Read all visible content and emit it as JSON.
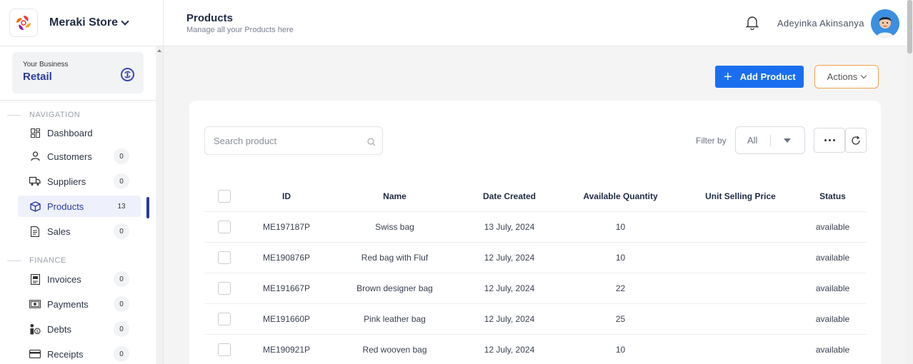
{
  "sidebar": {
    "store_name": "Meraki Store",
    "business": {
      "label": "Your Business",
      "value": "Retail"
    },
    "navigation_label": "NAVIGATION",
    "finance_label": "FINANCE",
    "nav": [
      {
        "label": "Dashboard",
        "count": "",
        "icon": "dashboard-icon"
      },
      {
        "label": "Customers",
        "count": "0",
        "icon": "user-icon"
      },
      {
        "label": "Suppliers",
        "count": "0",
        "icon": "truck-icon"
      },
      {
        "label": "Products",
        "count": "13",
        "icon": "box-icon"
      },
      {
        "label": "Sales",
        "count": "0",
        "icon": "document-icon"
      }
    ],
    "finance": [
      {
        "label": "Invoices",
        "count": "0",
        "icon": "invoice-icon"
      },
      {
        "label": "Payments",
        "count": "0",
        "icon": "cash-icon"
      },
      {
        "label": "Debts",
        "count": "0",
        "icon": "debt-icon"
      },
      {
        "label": "Receipts",
        "count": "0",
        "icon": "card-icon"
      }
    ]
  },
  "header": {
    "title": "Products",
    "subtitle": "Manage all your Products here",
    "user_name": "Adeyinka Akinsanya"
  },
  "toolbar": {
    "add_label": "Add Product",
    "actions_label": "Actions"
  },
  "filters": {
    "search_placeholder": "Search product",
    "filter_label": "Filter by",
    "filter_value": "All"
  },
  "table": {
    "columns": [
      "ID",
      "Name",
      "Date Created",
      "Available Quantity",
      "Unit Selling Price",
      "Status"
    ],
    "rows": [
      {
        "id": "ME197187P",
        "name": "Swiss bag",
        "date": "13 July, 2024",
        "qty": "10",
        "price": "",
        "status": "available"
      },
      {
        "id": "ME190876P",
        "name": "Red bag with Fluf",
        "date": "12 July, 2024",
        "qty": "10",
        "price": "",
        "status": "available"
      },
      {
        "id": "ME191667P",
        "name": "Brown designer bag",
        "date": "12 July, 2024",
        "qty": "22",
        "price": "",
        "status": "available"
      },
      {
        "id": "ME191660P",
        "name": "Pink leather bag",
        "date": "12 July, 2024",
        "qty": "25",
        "price": "",
        "status": "available"
      },
      {
        "id": "ME190921P",
        "name": "Red wooven bag",
        "date": "12 July, 2024",
        "qty": "10",
        "price": "",
        "status": "available"
      }
    ]
  },
  "colors": {
    "primary": "#1a6ff0",
    "brand_navy": "#2b3a9c",
    "actions_border": "#f0a24a"
  }
}
